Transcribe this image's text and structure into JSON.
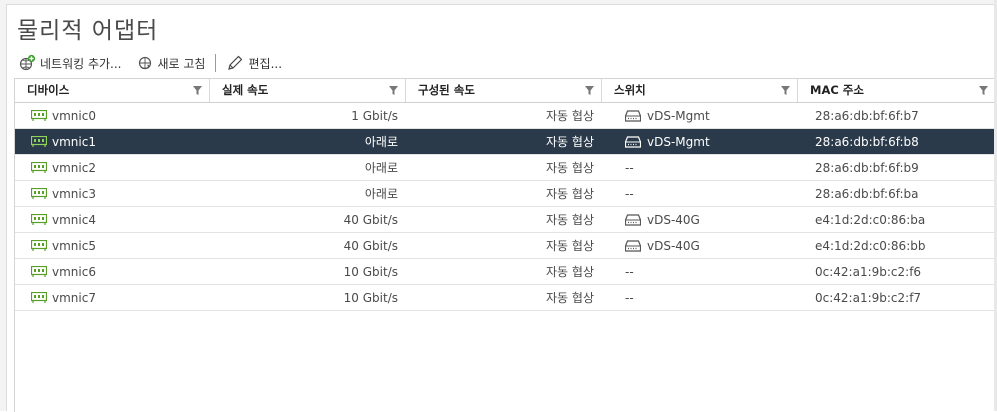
{
  "title": "물리적 어댑터",
  "toolbar": {
    "add_networking": "네트워킹 추가...",
    "refresh": "새로 고침",
    "edit": "편집..."
  },
  "columns": [
    "디바이스",
    "실제 속도",
    "구성된 속도",
    "스위치",
    "MAC 주소"
  ],
  "rows": [
    {
      "device": "vmnic0",
      "actual_speed": "1 Gbit/s",
      "configured_speed": "자동 협상",
      "switch": "vDS-Mgmt",
      "switch_icon": "switch-icon",
      "mac": "28:a6:db:bf:6f:b7",
      "selected": false
    },
    {
      "device": "vmnic1",
      "actual_speed": "아래로",
      "configured_speed": "자동 협상",
      "switch": "vDS-Mgmt",
      "switch_icon": "switch-icon",
      "mac": "28:a6:db:bf:6f:b8",
      "selected": true
    },
    {
      "device": "vmnic2",
      "actual_speed": "아래로",
      "configured_speed": "자동 협상",
      "switch": "--",
      "switch_icon": null,
      "mac": "28:a6:db:bf:6f:b9",
      "selected": false
    },
    {
      "device": "vmnic3",
      "actual_speed": "아래로",
      "configured_speed": "자동 협상",
      "switch": "--",
      "switch_icon": null,
      "mac": "28:a6:db:bf:6f:ba",
      "selected": false
    },
    {
      "device": "vmnic4",
      "actual_speed": "40 Gbit/s",
      "configured_speed": "자동 협상",
      "switch": "vDS-40G",
      "switch_icon": "switch-icon",
      "mac": "e4:1d:2d:c0:86:ba",
      "selected": false
    },
    {
      "device": "vmnic5",
      "actual_speed": "40 Gbit/s",
      "configured_speed": "자동 협상",
      "switch": "vDS-40G",
      "switch_icon": "switch-icon",
      "mac": "e4:1d:2d:c0:86:bb",
      "selected": false
    },
    {
      "device": "vmnic6",
      "actual_speed": "10 Gbit/s",
      "configured_speed": "자동 협상",
      "switch": "--",
      "switch_icon": null,
      "mac": "0c:42:a1:9b:c2:f6",
      "selected": false
    },
    {
      "device": "vmnic7",
      "actual_speed": "10 Gbit/s",
      "configured_speed": "자동 협상",
      "switch": "--",
      "switch_icon": null,
      "mac": "0c:42:a1:9b:c2:f7",
      "selected": false
    }
  ],
  "colors": {
    "selected_row": "#2b3a4a",
    "nic_icon": "#5a9e2a"
  }
}
